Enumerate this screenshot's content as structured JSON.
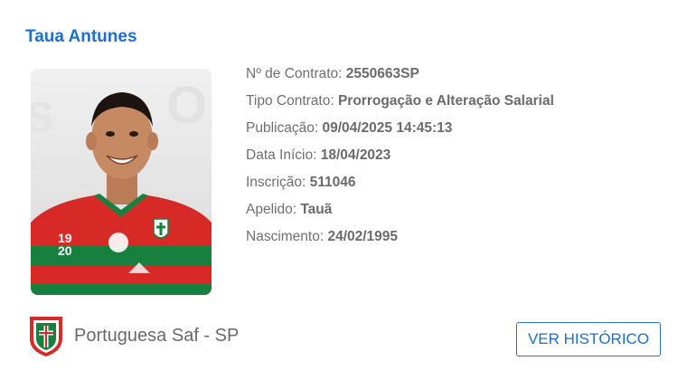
{
  "player": {
    "name": "Taua Antunes"
  },
  "details": [
    {
      "label": "Nº de Contrato: ",
      "value": "2550663SP"
    },
    {
      "label": "Tipo Contrato: ",
      "value": "Prorrogação e Alteração Salarial"
    },
    {
      "label": "Publicação: ",
      "value": "09/04/2025 14:45:13"
    },
    {
      "label": "Data Início: ",
      "value": "18/04/2023"
    },
    {
      "label": "Inscrição: ",
      "value": "511046"
    },
    {
      "label": "Apelido: ",
      "value": "Tauã"
    },
    {
      "label": "Nascimento: ",
      "value": "24/02/1995"
    }
  ],
  "club": {
    "name": "Portuguesa Saf - SP",
    "crest_icon": "portuguesa-crest-icon"
  },
  "actions": {
    "history_label": "VER HISTÓRICO"
  },
  "colors": {
    "accent": "#1d6fd6",
    "jersey_red": "#d72a26",
    "jersey_green": "#17803f"
  }
}
